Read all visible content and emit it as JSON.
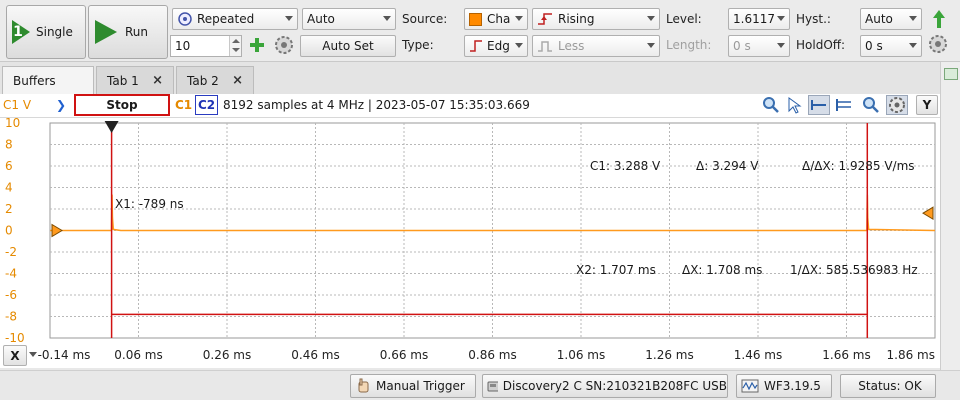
{
  "toolbar": {
    "single_label": "Single",
    "single_number": "1",
    "run_label": "Run",
    "mode": "Repeated",
    "auto": "Auto",
    "count": "10",
    "auto_set": "Auto Set",
    "source_label": "Source:",
    "source_value": "Cha",
    "source_color": "#ff8a00",
    "type_label": "Type:",
    "type_value": "Edg",
    "condition_value": "Rising",
    "condition2_value": "Less",
    "level_label": "Level:",
    "level_value": "1.6117",
    "length_label": "Length:",
    "length_value": "0 s",
    "hyst_label": "Hyst.:",
    "hyst_value": "Auto",
    "holdoff_label": "HoldOff:",
    "holdoff_value": "0 s"
  },
  "tabs": [
    {
      "label": "Buffers"
    },
    {
      "label": "Tab 1",
      "close": "×"
    },
    {
      "label": "Tab 2",
      "close": "×"
    }
  ],
  "scope": {
    "channel_axis_label": "C1 V",
    "stop_label": "Stop",
    "c1_label": "C1",
    "c2_label": "C2",
    "info": "8192 samples at 4 MHz | 2023-05-07 15:35:03.669",
    "y_button": "Y",
    "x_button": "X",
    "c1_color": "#e58a00",
    "c2_color": "#1f33b5",
    "trace_color": "#ff9a1e",
    "cursor_color": "#d01212",
    "stop_border": "#d01212"
  },
  "cursors": {
    "x1_label": "X1: -789 ns",
    "c1_value": "C1: 3.288 V",
    "delta_v": "Δ: 3.294 V",
    "slope": "Δ/ΔX: 1.9285 V/ms",
    "x2_label": "X2: 1.707 ms",
    "delta_x": "ΔX: 1.708 ms",
    "freq": "1/ΔX: 585.536983 Hz"
  },
  "chart_data": {
    "type": "line",
    "title": "",
    "xlabel": "",
    "ylabel": "C1 V",
    "xlim": [
      -0.14,
      1.86
    ],
    "ylim": [
      -10,
      10
    ],
    "x_ticks": [
      "-0.14 ms",
      "0.06 ms",
      "0.26 ms",
      "0.46 ms",
      "0.66 ms",
      "0.86 ms",
      "1.06 ms",
      "1.26 ms",
      "1.46 ms",
      "1.66 ms",
      "1.86 ms"
    ],
    "y_ticks": [
      "10",
      "8",
      "6",
      "4",
      "2",
      "0",
      "-2",
      "-4",
      "-6",
      "-8",
      "-10"
    ],
    "grid": true,
    "series": [
      {
        "name": "C1",
        "x": [
          -0.14,
          -0.001,
          0.0,
          0.001,
          0.003,
          0.02,
          1.7,
          1.706,
          1.707,
          1.708,
          1.71,
          1.86
        ],
        "y": [
          0,
          0,
          3.3,
          1.2,
          0.1,
          0,
          0,
          0,
          3.3,
          1.2,
          0.1,
          0
        ]
      }
    ],
    "cursors": [
      {
        "name": "X1",
        "x": -0.000789
      },
      {
        "name": "X2",
        "x": 1.707
      }
    ],
    "trigger_level": 1.6117
  },
  "statusbar": {
    "manual_trigger": "Manual Trigger",
    "device": "Discovery2 C SN:210321B208FC USB",
    "version": "WF3.19.5",
    "status": "Status: OK"
  }
}
